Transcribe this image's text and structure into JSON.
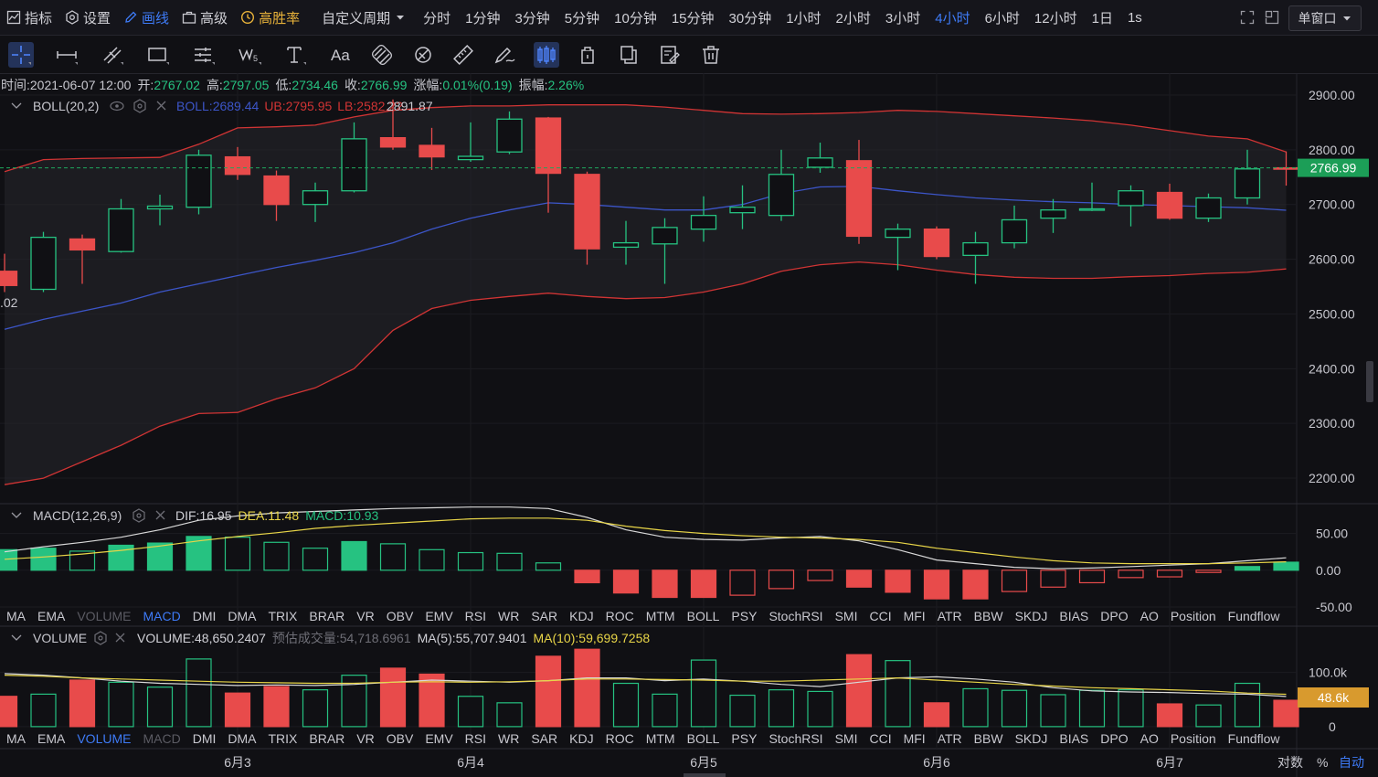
{
  "toolbar": {
    "indicators": "指标",
    "settings": "设置",
    "draw": "画线",
    "advanced": "高级",
    "win_rate": "高胜率",
    "custom_period": "自定义周期",
    "periods": [
      "分时",
      "1分钟",
      "3分钟",
      "5分钟",
      "10分钟",
      "15分钟",
      "30分钟",
      "1小时",
      "2小时",
      "3小时",
      "4小时",
      "6小时",
      "12小时",
      "1日",
      "1s"
    ],
    "active_period": "4小时",
    "window_mode": "单窗口"
  },
  "ohlc": {
    "time_label": "时间:",
    "time": "2021-06-07 12:00",
    "open_label": "开:",
    "open": "2767.02",
    "high_label": "高:",
    "high": "2797.05",
    "low_label": "低:",
    "low": "2734.46",
    "close_label": "收:",
    "close": "2766.99",
    "change_label": "涨幅:",
    "change": "0.01%(0.19)",
    "amp_label": "振幅:",
    "amp": "2.26%"
  },
  "boll": {
    "name": "BOLL(20,2)",
    "mid_label": "BOLL:",
    "mid": "2689.44",
    "ub_label": "UB:",
    "ub": "2795.95",
    "lb_label": "LB:",
    "lb": "2582.22",
    "max_marker": "2891.87",
    "left_marker": ".02"
  },
  "macd": {
    "name": "MACD(12,26,9)",
    "dif_label": "DIF:",
    "dif": "16.95",
    "dea_label": "DEA:",
    "dea": "11.48",
    "macd_label": "MACD:",
    "macd": "10.93"
  },
  "volume": {
    "name": "VOLUME",
    "vol_label": "VOLUME:",
    "vol": "48,650.2407",
    "est_label": "预估成交量:",
    "est": "54,718.6961",
    "ma5_label": "MA(5):",
    "ma5": "55,707.9401",
    "ma10_label": "MA(10):",
    "ma10": "59,699.7258",
    "current_badge": "48.6k"
  },
  "indicator_tabs": [
    "MA",
    "EMA",
    "VOLUME",
    "MACD",
    "DMI",
    "DMA",
    "TRIX",
    "BRAR",
    "VR",
    "OBV",
    "EMV",
    "RSI",
    "WR",
    "SAR",
    "KDJ",
    "ROC",
    "MTM",
    "BOLL",
    "PSY",
    "StochRSI",
    "SMI",
    "CCI",
    "MFI",
    "ATR",
    "BBW",
    "SKDJ",
    "BIAS",
    "DPO",
    "AO",
    "Position",
    "Fundflow"
  ],
  "indicator_tabs_row1_active": "MACD",
  "indicator_tabs_row1_dim": "VOLUME",
  "indicator_tabs_row2_active": "VOLUME",
  "indicator_tabs_row2_dim": "MACD",
  "x_axis": {
    "labels": [
      "6月3",
      "6月4",
      "6月5",
      "6月6",
      "6月7"
    ],
    "log_label": "对数",
    "pct_label": "%",
    "auto_label": "自动"
  },
  "colors": {
    "up": "#26c281",
    "down": "#e84b4b",
    "boll_mid": "#3c55c8",
    "boll_band": "#d03434",
    "dif": "#d9d9d9",
    "dea": "#e8d548",
    "accent": "#3e7bf7",
    "badge": "#d89a2e",
    "last_price": "#1c9e57"
  },
  "chart_data": [
    {
      "type": "candlestick",
      "title": "BOLL(20,2)",
      "y_ticks": [
        2200,
        2300,
        2400,
        2500,
        2600,
        2700,
        2800,
        2900
      ],
      "y_tick_labels": [
        "2200.00",
        "2300.00",
        "2400.00",
        "2500.00",
        "2600.00",
        "2700.00",
        "2800.00",
        "2900.00"
      ],
      "ylim": [
        2155,
        2935
      ],
      "last_price": 2766.99,
      "last_price_label": "2766.99",
      "x_date_labels": {
        "6月3": 6,
        "6月4": 12,
        "6月5": 18,
        "6月6": 24,
        "6月7": 30
      },
      "candles": [
        {
          "o": 2578,
          "h": 2610,
          "l": 2540,
          "c": 2552
        },
        {
          "o": 2545,
          "h": 2650,
          "l": 2540,
          "c": 2640
        },
        {
          "o": 2637,
          "h": 2645,
          "l": 2555,
          "c": 2617
        },
        {
          "o": 2614,
          "h": 2710,
          "l": 2612,
          "c": 2692
        },
        {
          "o": 2692,
          "h": 2718,
          "l": 2662,
          "c": 2697
        },
        {
          "o": 2695,
          "h": 2800,
          "l": 2682,
          "c": 2790
        },
        {
          "o": 2787,
          "h": 2805,
          "l": 2745,
          "c": 2755
        },
        {
          "o": 2752,
          "h": 2762,
          "l": 2670,
          "c": 2700
        },
        {
          "o": 2700,
          "h": 2740,
          "l": 2668,
          "c": 2725
        },
        {
          "o": 2725,
          "h": 2850,
          "l": 2722,
          "c": 2820
        },
        {
          "o": 2822,
          "h": 2891.87,
          "l": 2800,
          "c": 2805
        },
        {
          "o": 2808,
          "h": 2840,
          "l": 2763,
          "c": 2787
        },
        {
          "o": 2782,
          "h": 2850,
          "l": 2778,
          "c": 2788
        },
        {
          "o": 2796,
          "h": 2870,
          "l": 2792,
          "c": 2856
        },
        {
          "o": 2858,
          "h": 2860,
          "l": 2685,
          "c": 2757
        },
        {
          "o": 2755,
          "h": 2760,
          "l": 2590,
          "c": 2619
        },
        {
          "o": 2622,
          "h": 2670,
          "l": 2590,
          "c": 2630
        },
        {
          "o": 2628,
          "h": 2675,
          "l": 2555,
          "c": 2658
        },
        {
          "o": 2655,
          "h": 2715,
          "l": 2632,
          "c": 2680
        },
        {
          "o": 2685,
          "h": 2735,
          "l": 2655,
          "c": 2695
        },
        {
          "o": 2680,
          "h": 2800,
          "l": 2670,
          "c": 2755
        },
        {
          "o": 2768,
          "h": 2813,
          "l": 2758,
          "c": 2785
        },
        {
          "o": 2780,
          "h": 2818,
          "l": 2628,
          "c": 2642
        },
        {
          "o": 2640,
          "h": 2665,
          "l": 2580,
          "c": 2655
        },
        {
          "o": 2655,
          "h": 2660,
          "l": 2600,
          "c": 2605
        },
        {
          "o": 2607,
          "h": 2650,
          "l": 2555,
          "c": 2630
        },
        {
          "o": 2630,
          "h": 2698,
          "l": 2620,
          "c": 2672
        },
        {
          "o": 2675,
          "h": 2710,
          "l": 2648,
          "c": 2690
        },
        {
          "o": 2690,
          "h": 2740,
          "l": 2688,
          "c": 2692
        },
        {
          "o": 2698,
          "h": 2735,
          "l": 2660,
          "c": 2725
        },
        {
          "o": 2722,
          "h": 2738,
          "l": 2672,
          "c": 2675
        },
        {
          "o": 2675,
          "h": 2720,
          "l": 2668,
          "c": 2712
        },
        {
          "o": 2712,
          "h": 2800,
          "l": 2700,
          "c": 2765
        },
        {
          "o": 2767.02,
          "h": 2797.05,
          "l": 2734.46,
          "c": 2766.99
        }
      ],
      "boll_mid": [
        2472,
        2490,
        2505,
        2520,
        2540,
        2555,
        2570,
        2585,
        2598,
        2612,
        2630,
        2655,
        2675,
        2690,
        2703,
        2700,
        2695,
        2690,
        2690,
        2700,
        2720,
        2732,
        2733,
        2725,
        2718,
        2712,
        2708,
        2705,
        2703,
        2700,
        2698,
        2696,
        2694,
        2689.44
      ],
      "boll_ub": [
        2760,
        2782,
        2784,
        2785,
        2786,
        2810,
        2840,
        2842,
        2845,
        2860,
        2872,
        2877,
        2880,
        2880,
        2882,
        2882,
        2882,
        2878,
        2872,
        2866,
        2865,
        2866,
        2868,
        2872,
        2870,
        2866,
        2862,
        2858,
        2853,
        2845,
        2835,
        2825,
        2820,
        2795.95
      ],
      "boll_lb": [
        2188,
        2200,
        2230,
        2260,
        2295,
        2318,
        2320,
        2345,
        2365,
        2400,
        2470,
        2510,
        2525,
        2532,
        2538,
        2532,
        2528,
        2530,
        2540,
        2555,
        2578,
        2590,
        2595,
        2590,
        2580,
        2572,
        2567,
        2565,
        2565,
        2568,
        2570,
        2574,
        2576,
        2582.22
      ]
    },
    {
      "type": "bar+line",
      "title": "MACD(12,26,9)",
      "y_ticks": [
        -50,
        0,
        50
      ],
      "y_tick_labels": [
        "-50.00",
        "0.00",
        "50.00"
      ],
      "ylim": [
        -60,
        62
      ],
      "histogram": [
        28,
        30,
        26,
        34,
        37,
        46,
        45,
        38,
        30,
        39,
        36,
        28,
        24,
        23,
        10,
        -17,
        -31,
        -37,
        -37,
        -34,
        -25,
        -14,
        -23,
        -30,
        -39,
        -39,
        -29,
        -23,
        -17,
        -10,
        -9,
        -3,
        5,
        10.93
      ],
      "dif": [
        25,
        32,
        38,
        45,
        55,
        68,
        74,
        78,
        80,
        82,
        84,
        85,
        86,
        86,
        84,
        72,
        55,
        45,
        42,
        41,
        44,
        46,
        40,
        28,
        14,
        9,
        4,
        2,
        3,
        5,
        7,
        9,
        13,
        16.95
      ],
      "dea": [
        15,
        18,
        22,
        27,
        33,
        40,
        46,
        51,
        57,
        61,
        64,
        67,
        70,
        71,
        71,
        68,
        60,
        54,
        50,
        47,
        45,
        44,
        42,
        38,
        30,
        24,
        18,
        13,
        10,
        9,
        9,
        9,
        10,
        11.48
      ]
    },
    {
      "type": "bar+line",
      "title": "VOLUME",
      "y_ticks": [
        0,
        100000
      ],
      "y_tick_labels": [
        "0",
        "100.0k"
      ],
      "ylim": [
        -12000,
        140000
      ],
      "volume": [
        56000,
        60000,
        86000,
        82000,
        73000,
        125000,
        62000,
        74000,
        68000,
        95000,
        108000,
        97000,
        56000,
        44000,
        130000,
        143000,
        80000,
        60000,
        123000,
        58000,
        68000,
        65000,
        133000,
        122000,
        44000,
        70000,
        67000,
        59000,
        67000,
        68000,
        42000,
        40000,
        80000,
        48650.2407
      ],
      "vol_up": [
        false,
        true,
        false,
        true,
        true,
        true,
        false,
        false,
        true,
        true,
        false,
        false,
        true,
        true,
        false,
        false,
        true,
        true,
        true,
        true,
        true,
        true,
        false,
        true,
        false,
        true,
        true,
        true,
        true,
        true,
        false,
        true,
        true,
        false
      ],
      "ma5": [
        98000,
        95000,
        90000,
        84000,
        80000,
        78000,
        76000,
        77000,
        76000,
        78000,
        82000,
        86000,
        84000,
        82000,
        85000,
        90000,
        90000,
        85000,
        88000,
        84000,
        78000,
        74000,
        82000,
        90000,
        92000,
        88000,
        82000,
        72000,
        66000,
        64000,
        63000,
        61000,
        60000,
        55707.9401
      ],
      "ma10": [
        95000,
        93000,
        90000,
        88000,
        86000,
        84000,
        82000,
        81000,
        80000,
        80000,
        82000,
        83000,
        82000,
        83000,
        85000,
        88000,
        88000,
        87000,
        86000,
        84000,
        84000,
        86000,
        88000,
        90000,
        86000,
        82000,
        78000,
        75000,
        72000,
        70000,
        68000,
        66000,
        62000,
        59699.7258
      ]
    }
  ]
}
